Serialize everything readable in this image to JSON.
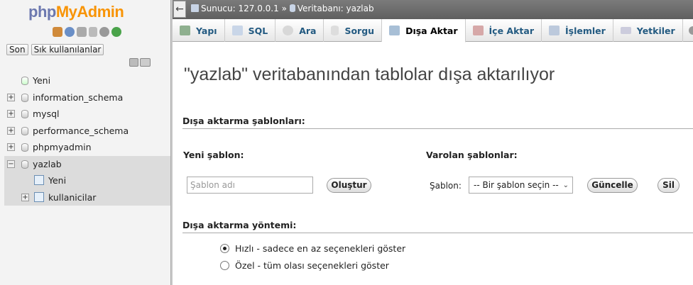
{
  "sidebar": {
    "logo_php": "php",
    "logo_admin": "MyAdmin",
    "recent_label": "Son",
    "favorites_label": "Sık kullanılanlar",
    "tree": [
      {
        "label": "Yeni"
      },
      {
        "label": "information_schema"
      },
      {
        "label": "mysql"
      },
      {
        "label": "performance_schema"
      },
      {
        "label": "phpmyadmin"
      },
      {
        "label": "yazlab"
      }
    ],
    "sub": [
      {
        "label": "Yeni"
      },
      {
        "label": "kullanicilar"
      }
    ]
  },
  "topbar": {
    "server": "Sunucu: 127.0.0.1",
    "separator": "»",
    "database": "Veritabanı: yazlab"
  },
  "tabs": [
    {
      "label": "Yapı"
    },
    {
      "label": "SQL"
    },
    {
      "label": "Ara"
    },
    {
      "label": "Sorgu"
    },
    {
      "label": "Dışa Aktar"
    },
    {
      "label": "İçe Aktar"
    },
    {
      "label": "İşlemler"
    },
    {
      "label": "Yetkiler"
    }
  ],
  "main": {
    "title": "\"yazlab\" veritabanından tablolar dışa aktarılıyor",
    "templates_heading": "Dışa aktarma şablonları:",
    "new_template_label": "Yeni şablon:",
    "existing_templates_label": "Varolan şablonlar:",
    "template_name_placeholder": "Şablon adı",
    "create_button": "Oluştur",
    "template_field_label": "Şablon:",
    "template_select_value": "-- Bir şablon seçin --",
    "update_button": "Güncelle",
    "delete_button": "Sil",
    "method_heading": "Dışa aktarma yöntemi:",
    "quick_option": "Hızlı - sadece en az seçenekleri göster",
    "custom_option": "Özel - tüm olası seçenekleri göster"
  }
}
